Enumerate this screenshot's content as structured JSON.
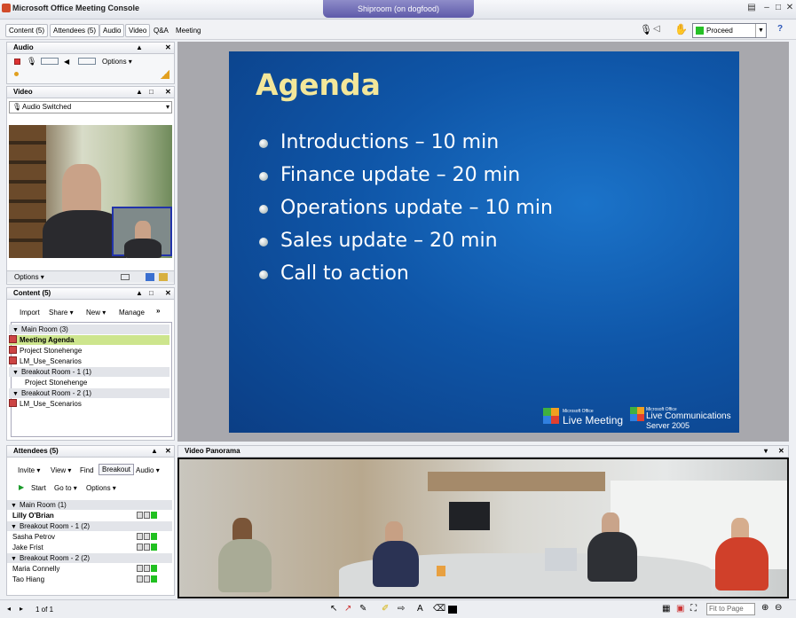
{
  "window": {
    "title": "Microsoft Office Meeting Console",
    "banner": "Shiproom (on dogfood)"
  },
  "toolbar": {
    "tabs": [
      "Content (5)",
      "Attendees (5)",
      "Audio",
      "Video",
      "Q&A",
      "Meeting"
    ],
    "status_select": "Proceed",
    "help": "?"
  },
  "audio_panel": {
    "title": "Audio",
    "options": "Options"
  },
  "video_panel": {
    "title": "Video",
    "mode": "Audio Switched",
    "options": "Options"
  },
  "content_panel": {
    "title": "Content (5)",
    "toolbar": [
      "Import",
      "Share",
      "New",
      "Manage"
    ],
    "rooms": [
      {
        "name": "Main Room (3)",
        "items": [
          "Meeting Agenda",
          "Project Stonehenge",
          "LM_Use_Scenarios"
        ]
      },
      {
        "name": "Breakout Room - 1 (1)",
        "items": [
          "Project Stonehenge"
        ]
      },
      {
        "name": "Breakout Room - 2 (1)",
        "items": [
          "LM_Use_Scenarios"
        ]
      }
    ]
  },
  "attendees_panel": {
    "title": "Attendees (5)",
    "toolbar": [
      "Invite",
      "View",
      "Find",
      "Breakout",
      "Audio"
    ],
    "toolbar2": [
      "Start",
      "Go to",
      "Options"
    ],
    "rooms": [
      {
        "name": "Main Room (1)",
        "people": [
          "Lilly O'Brian"
        ]
      },
      {
        "name": "Breakout Room - 1 (2)",
        "people": [
          "Sasha Petrov",
          "Jake Frist"
        ]
      },
      {
        "name": "Breakout Room - 2 (2)",
        "people": [
          "Maria Connelly",
          "Tao Hiang"
        ]
      }
    ]
  },
  "slide": {
    "title": "Agenda",
    "bullets": [
      "Introductions – 10 min",
      "Finance update – 20 min",
      "Operations update – 10 min",
      "Sales update – 20 min",
      "Call to action"
    ],
    "logo1_small": "Microsoft Office",
    "logo1": "Live Meeting",
    "logo2_small": "Microsoft Office",
    "logo2": "Live Communications",
    "logo2_b": "Server 2005"
  },
  "panorama": {
    "title": "Video Panorama"
  },
  "statusbar": {
    "page": "1 of 1",
    "zoom": "Fit to Page"
  },
  "colors": {
    "slide_bg": "#0f56a8",
    "slide_title": "#f3e79a",
    "selected_row": "#cde58d",
    "presence_green": "#20c020"
  }
}
